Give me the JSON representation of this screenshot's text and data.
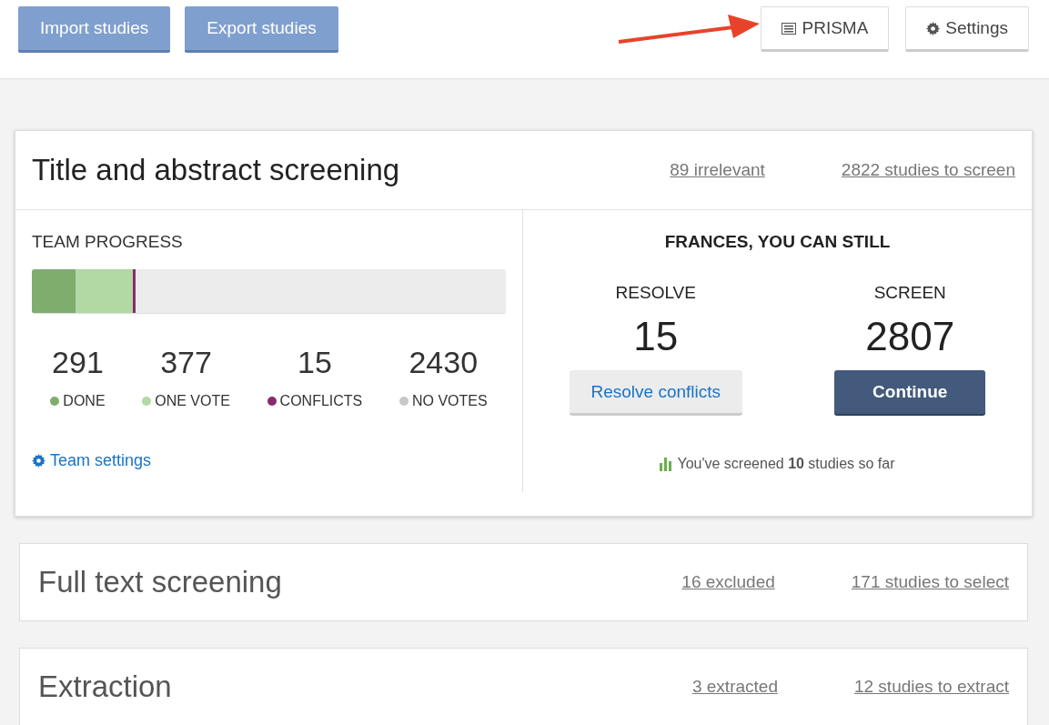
{
  "toolbar": {
    "left_buttons": [
      "Import studies",
      "Export studies"
    ],
    "right_buttons": [
      {
        "kind": "prisma",
        "label": "PRISMA"
      },
      {
        "kind": "settings",
        "label": "Settings"
      }
    ]
  },
  "title_abstract": {
    "title": "Title and abstract screening",
    "links": [
      "89 irrelevant",
      "2822 studies to screen"
    ],
    "team_progress": {
      "heading": "TEAM PROGRESS",
      "progress_bar": [
        {
          "color": "#7fad6e",
          "level": 0.093
        },
        {
          "color": "#b2d8a4",
          "level": 0.121
        },
        {
          "color": "#8a2a6c",
          "level": 0.004
        }
      ],
      "segments": [
        {
          "label": "DONE",
          "count": "291",
          "color": "#7fad6e"
        },
        {
          "label": "ONE VOTE",
          "count": "377",
          "color": "#b2d8a4"
        },
        {
          "label": "CONFLICTS",
          "count": "15",
          "color": "#8a2a6c"
        },
        {
          "label": "NO VOTES",
          "count": "2430",
          "color": "#c8c8c8"
        }
      ],
      "settings_link": "Team settings"
    },
    "user_panel": {
      "heading": "FRANCES, YOU CAN STILL",
      "actions": [
        {
          "kind": "secondary",
          "label": "RESOLVE",
          "count": "15",
          "button": "Resolve conflicts"
        },
        {
          "kind": "primary",
          "label": "SCREEN",
          "count": "2807",
          "button": "Continue"
        }
      ],
      "note": "You've screened **10** studies so far"
    }
  },
  "stages": [
    {
      "title": "Full text screening",
      "links": [
        "16 excluded",
        "171 studies to select"
      ]
    },
    {
      "title": "Extraction",
      "links": [
        "3 extracted",
        "12 studies to extract"
      ]
    }
  ]
}
